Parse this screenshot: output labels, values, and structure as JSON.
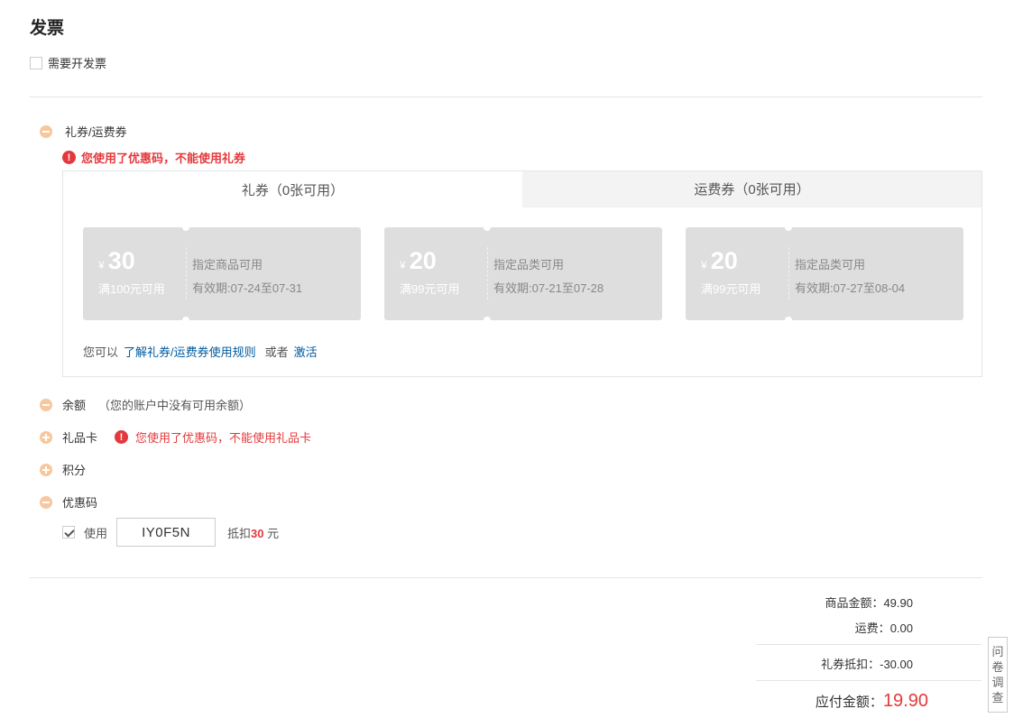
{
  "invoice": {
    "title": "发票",
    "checkbox_label": "需要开发票"
  },
  "coupon_section": {
    "label": "礼券/运费券",
    "error": "您使用了优惠码，不能使用礼券",
    "tabs": [
      {
        "label": "礼券（0张可用）"
      },
      {
        "label": "运费券（0张可用）"
      }
    ],
    "coupons": [
      {
        "currency": "¥",
        "amount": "30",
        "condition": "满100元可用",
        "scope": "指定商品可用",
        "validity": "有效期:07-24至07-31"
      },
      {
        "currency": "¥",
        "amount": "20",
        "condition": "满99元可用",
        "scope": "指定品类可用",
        "validity": "有效期:07-21至07-28"
      },
      {
        "currency": "¥",
        "amount": "20",
        "condition": "满99元可用",
        "scope": "指定品类可用",
        "validity": "有效期:07-27至08-04"
      }
    ],
    "rules_prefix": "您可以",
    "rules_link": "了解礼券/运费券使用规则",
    "rules_or": "或者",
    "activate_link": "激活"
  },
  "balance": {
    "label": "余额",
    "note": "（您的账户中没有可用余额）"
  },
  "gift_card": {
    "label": "礼品卡",
    "error": "您使用了优惠码，不能使用礼品卡"
  },
  "points": {
    "label": "积分"
  },
  "promo_code": {
    "label": "优惠码",
    "use_label": "使用",
    "code": "IY0F5N",
    "deduct_prefix": "抵扣",
    "deduct_amount": "30",
    "deduct_unit": "元"
  },
  "summary": {
    "goods_label": "商品金额：",
    "goods_value": "49.90",
    "shipping_label": "运费：",
    "shipping_value": "0.00",
    "coupon_label": "礼券抵扣：",
    "coupon_value": "-30.00",
    "total_label": "应付金额：",
    "total_value": "19.90"
  },
  "survey": {
    "chars": [
      "问",
      "卷",
      "调",
      "查"
    ]
  },
  "colors": {
    "accent_red": "#e4393c",
    "link_blue": "#005aa0",
    "toggle_orange": "#f7c79f",
    "coupon_gray": "#dedede"
  }
}
